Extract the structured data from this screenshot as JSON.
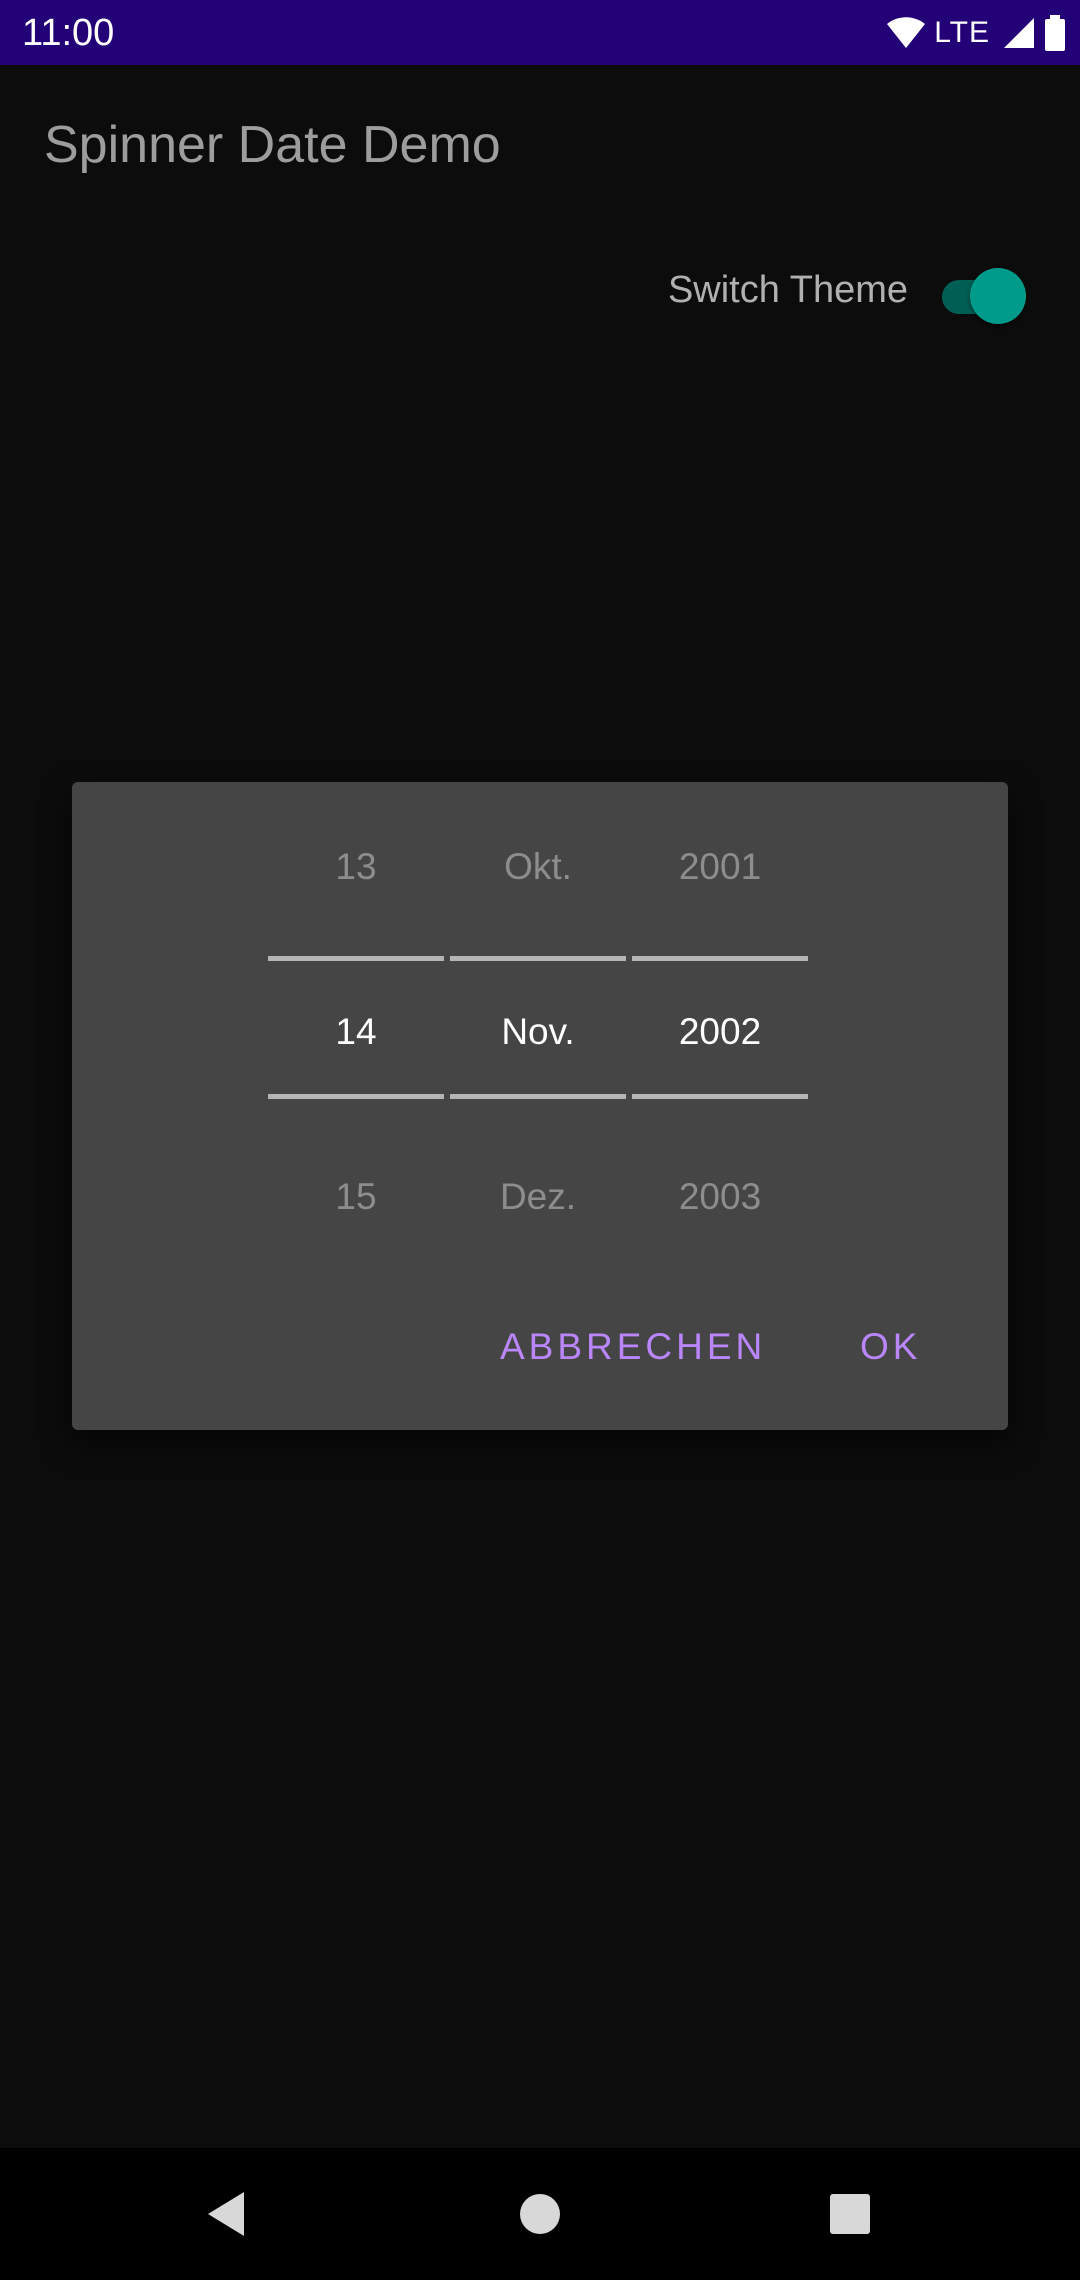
{
  "status_bar": {
    "time": "11:00",
    "network": "LTE"
  },
  "app_bar": {
    "title": "Spinner Date Demo"
  },
  "theme_switch": {
    "label": "Switch Theme",
    "checked": true
  },
  "date_picker": {
    "day": {
      "prev": "13",
      "current": "14",
      "next": "15"
    },
    "month": {
      "prev": "Okt.",
      "current": "Nov.",
      "next": "Dez."
    },
    "year": {
      "prev": "2001",
      "current": "2002",
      "next": "2003"
    },
    "buttons": {
      "cancel": "ABBRECHEN",
      "ok": "OK"
    }
  },
  "colors": {
    "status_bar": "#230277",
    "background": "#0c0c0c",
    "dialog": "#454545",
    "accent_button": "#bb86fc",
    "switch_thumb": "#009b8a"
  },
  "icons": [
    "wifi-icon",
    "signal-icon",
    "battery-icon",
    "back-icon",
    "home-icon",
    "recents-icon"
  ]
}
